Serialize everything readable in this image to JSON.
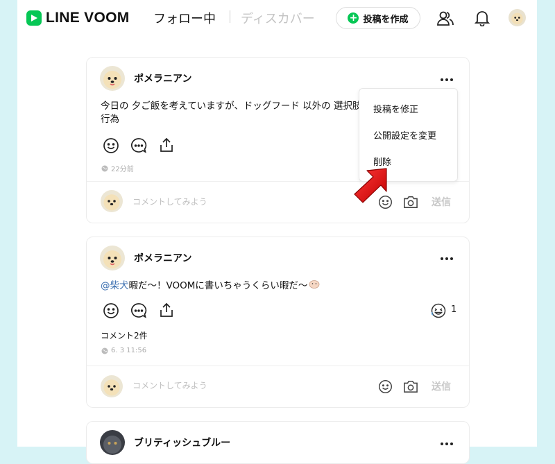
{
  "header": {
    "logo": "LINE VOOM",
    "tab_follow": "フォロー中",
    "tab_discover": "ディスカバー",
    "post_button": "投稿を作成"
  },
  "posts": [
    {
      "username": "ポメラニアン",
      "text_line1": "今日の 夕ご飯を考えていますが、ドッグフード 以外の 選択肢",
      "text_line2": "行為",
      "time": "22分前",
      "comment_placeholder": "コメントしてみよう",
      "send": "送信"
    },
    {
      "username": "ポメラニアン",
      "mention": "@柴犬",
      "text": " 暇だ～！VOOMに書いちゃうくらい暇だ～",
      "like_count": "1",
      "comments": "コメント2件",
      "time": "6. 3 11:56",
      "comment_placeholder": "コメントしてみよう",
      "send": "送信"
    },
    {
      "username": "ブリティッシュブルー"
    }
  ],
  "menu": {
    "items": [
      "投稿を修正",
      "公開設定を変更",
      "削除"
    ]
  },
  "colors": {
    "background": "#d7f3f6",
    "brand_green": "#06c755",
    "arrow_red": "#e01010"
  }
}
